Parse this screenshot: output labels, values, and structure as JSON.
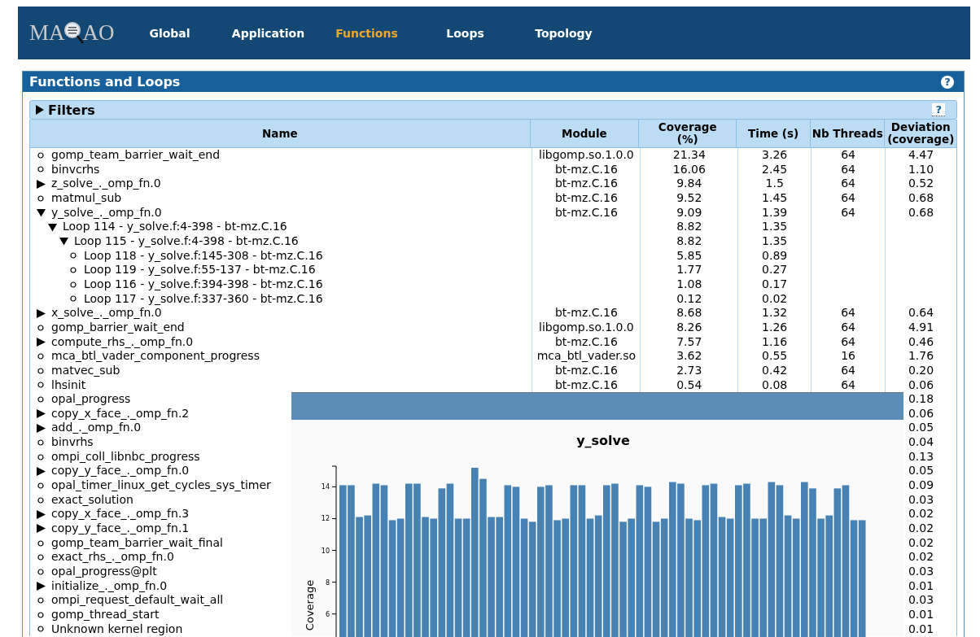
{
  "logo": {
    "left": "MA",
    "right": "AO"
  },
  "nav": [
    {
      "label": "Global",
      "selected": false
    },
    {
      "label": "Application",
      "selected": false
    },
    {
      "label": "Functions",
      "selected": true
    },
    {
      "label": "Loops",
      "selected": false
    },
    {
      "label": "Topology",
      "selected": false
    }
  ],
  "panel": {
    "title": "Functions and Loops",
    "help": "?"
  },
  "filters": {
    "label": "Filters",
    "expanded": false,
    "help": "?"
  },
  "table": {
    "columns": [
      "Name",
      "Module",
      "Coverage (%)",
      "Time (s)",
      "Nb Threads",
      "Deviation (coverage)"
    ],
    "rows": [
      {
        "name": "gomp_team_barrier_wait_end",
        "kind": "leaf",
        "module": "libgomp.so.1.0.0",
        "coverage": "21.34",
        "time": "3.26",
        "threads": "64",
        "deviation": "4.47"
      },
      {
        "name": "binvcrhs",
        "kind": "leaf",
        "module": "bt-mz.C.16",
        "coverage": "16.06",
        "time": "2.45",
        "threads": "64",
        "deviation": "1.10"
      },
      {
        "name": "z_solve_._omp_fn.0",
        "kind": "group",
        "expanded": false,
        "module": "bt-mz.C.16",
        "coverage": "9.84",
        "time": "1.5",
        "threads": "64",
        "deviation": "0.52"
      },
      {
        "name": "matmul_sub",
        "kind": "leaf",
        "module": "bt-mz.C.16",
        "coverage": "9.52",
        "time": "1.45",
        "threads": "64",
        "deviation": "0.68"
      },
      {
        "name": "y_solve_._omp_fn.0",
        "kind": "group",
        "expanded": true,
        "module": "bt-mz.C.16",
        "coverage": "9.09",
        "time": "1.39",
        "threads": "64",
        "deviation": "0.68",
        "children": [
          {
            "name": "Loop 114 - y_solve.f:4-398 - bt-mz.C.16",
            "kind": "group",
            "expanded": true,
            "coverage": "8.82",
            "time": "1.35",
            "children": [
              {
                "name": "Loop 115 - y_solve.f:4-398 - bt-mz.C.16",
                "kind": "group",
                "expanded": true,
                "coverage": "8.82",
                "time": "1.35",
                "children": [
                  {
                    "name": "Loop 118 - y_solve.f:145-308 - bt-mz.C.16",
                    "kind": "leaf",
                    "coverage": "5.85",
                    "time": "0.89"
                  },
                  {
                    "name": "Loop 119 - y_solve.f:55-137 - bt-mz.C.16",
                    "kind": "leaf",
                    "coverage": "1.77",
                    "time": "0.27"
                  },
                  {
                    "name": "Loop 116 - y_solve.f:394-398 - bt-mz.C.16",
                    "kind": "leaf",
                    "coverage": "1.08",
                    "time": "0.17"
                  },
                  {
                    "name": "Loop 117 - y_solve.f:337-360 - bt-mz.C.16",
                    "kind": "leaf",
                    "coverage": "0.12",
                    "time": "0.02"
                  }
                ]
              }
            ]
          }
        ]
      },
      {
        "name": "x_solve_._omp_fn.0",
        "kind": "group",
        "expanded": false,
        "module": "bt-mz.C.16",
        "coverage": "8.68",
        "time": "1.32",
        "threads": "64",
        "deviation": "0.64"
      },
      {
        "name": "gomp_barrier_wait_end",
        "kind": "leaf",
        "module": "libgomp.so.1.0.0",
        "coverage": "8.26",
        "time": "1.26",
        "threads": "64",
        "deviation": "4.91"
      },
      {
        "name": "compute_rhs_._omp_fn.0",
        "kind": "group",
        "expanded": false,
        "module": "bt-mz.C.16",
        "coverage": "7.57",
        "time": "1.16",
        "threads": "64",
        "deviation": "0.46"
      },
      {
        "name": "mca_btl_vader_component_progress",
        "kind": "leaf",
        "module": "mca_btl_vader.so",
        "coverage": "3.62",
        "time": "0.55",
        "threads": "16",
        "deviation": "1.76"
      },
      {
        "name": "matvec_sub",
        "kind": "leaf",
        "module": "bt-mz.C.16",
        "coverage": "2.73",
        "time": "0.42",
        "threads": "64",
        "deviation": "0.20"
      },
      {
        "name": "lhsinit",
        "kind": "leaf",
        "module": "bt-mz.C.16",
        "coverage": "0.54",
        "time": "0.08",
        "threads": "64",
        "deviation": "0.06"
      },
      {
        "name": "opal_progress",
        "kind": "leaf",
        "deviation": "0.18"
      },
      {
        "name": "copy_x_face_._omp_fn.2",
        "kind": "group",
        "expanded": false,
        "deviation": "0.06"
      },
      {
        "name": "add_._omp_fn.0",
        "kind": "group",
        "expanded": false,
        "deviation": "0.05"
      },
      {
        "name": "binvrhs",
        "kind": "leaf",
        "deviation": "0.04"
      },
      {
        "name": "ompi_coll_libnbc_progress",
        "kind": "leaf",
        "deviation": "0.13"
      },
      {
        "name": "copy_y_face_._omp_fn.0",
        "kind": "group",
        "expanded": false,
        "deviation": "0.05"
      },
      {
        "name": "opal_timer_linux_get_cycles_sys_timer",
        "kind": "leaf",
        "deviation": "0.09"
      },
      {
        "name": "exact_solution",
        "kind": "leaf",
        "deviation": "0.03"
      },
      {
        "name": "copy_x_face_._omp_fn.3",
        "kind": "group",
        "expanded": false,
        "deviation": "0.02"
      },
      {
        "name": "copy_y_face_._omp_fn.1",
        "kind": "group",
        "expanded": false,
        "deviation": "0.02"
      },
      {
        "name": "gomp_team_barrier_wait_final",
        "kind": "leaf",
        "deviation": "0.02"
      },
      {
        "name": "exact_rhs_._omp_fn.0",
        "kind": "leaf",
        "deviation": "0.02"
      },
      {
        "name": "opal_progress@plt",
        "kind": "leaf",
        "deviation": "0.03"
      },
      {
        "name": "initialize_._omp_fn.0",
        "kind": "group",
        "expanded": false,
        "deviation": "0.01"
      },
      {
        "name": "ompi_request_default_wait_all",
        "kind": "leaf",
        "deviation": "0.03"
      },
      {
        "name": "gomp_thread_start",
        "kind": "leaf",
        "deviation": "0.01"
      },
      {
        "name": "Unknown kernel region",
        "kind": "leaf",
        "deviation": "0.01"
      }
    ]
  },
  "chart_popup": {
    "chart_data": {
      "type": "bar",
      "title": "y_solve",
      "ylabel": "Coverage",
      "ylim": [
        4.5,
        15.3
      ],
      "yticks": [
        6,
        8,
        10,
        12,
        14
      ],
      "series": [
        {
          "color": "#4682b4",
          "values": [
            14.1,
            14.1,
            12.1,
            12.2,
            14.2,
            14.1,
            11.9,
            12.0,
            14.2,
            14.2,
            12.1,
            12.0,
            13.9,
            14.2,
            12.0,
            12.0,
            15.2,
            14.5,
            12.1,
            12.1,
            14.1,
            14.0,
            12.0,
            11.8,
            14.0,
            14.1,
            11.9,
            12.0,
            14.1,
            14.1,
            12.0,
            12.2,
            14.1,
            14.2,
            11.8,
            12.0,
            14.1,
            14.0,
            11.8,
            12.0,
            14.3,
            14.2,
            12.0,
            11.9,
            14.1,
            14.2,
            12.1,
            12.0,
            14.1,
            14.2,
            12.0,
            12.0,
            14.3,
            14.1,
            12.2,
            12.0,
            14.3,
            13.9,
            12.0,
            12.2,
            13.9,
            14.1,
            11.9,
            11.9
          ]
        }
      ]
    }
  }
}
